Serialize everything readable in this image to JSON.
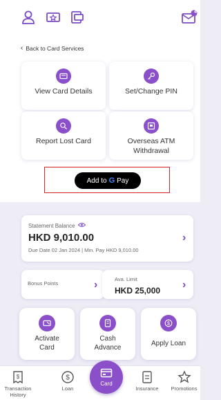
{
  "header": {
    "notification_count": "4"
  },
  "back_link": {
    "label": "Back to Card Services"
  },
  "tiles": [
    {
      "label": "View Card Details"
    },
    {
      "label": "Set/Change PIN"
    },
    {
      "label": "Report Lost Card"
    },
    {
      "label": "Overseas ATM Withdrawal"
    }
  ],
  "gpay": {
    "prefix": "Add to",
    "g": "G",
    "suffix": "Pay"
  },
  "statement": {
    "label": "Statement Balance",
    "amount": "HKD 9,010.00",
    "due": "Due Date 02 Jan 2024 | Min. Pay HKD 9,010.00"
  },
  "bonus": {
    "label": "Bonus Points"
  },
  "limit": {
    "label": "Ava. Limit",
    "amount": "HKD 25,000"
  },
  "actions": [
    {
      "label": "Activate Card",
      "icon": "activate-card-icon"
    },
    {
      "label": "Cash Advance",
      "icon": "cash-advance-icon"
    },
    {
      "label": "Apply Loan",
      "icon": "dollar-icon"
    }
  ],
  "nav": {
    "items": [
      {
        "label": "Transaction History",
        "icon": "receipt-dollar-icon"
      },
      {
        "label": "Loan",
        "icon": "dollar-circle-icon"
      },
      {
        "label": "Card",
        "icon": "card-icon"
      },
      {
        "label": "Insurance",
        "icon": "document-icon"
      },
      {
        "label": "Promotions",
        "icon": "star-icon"
      }
    ]
  },
  "colors": {
    "accent": "#8b4fc9",
    "highlight_border": "#d8232a",
    "background": "#eeedf6"
  }
}
